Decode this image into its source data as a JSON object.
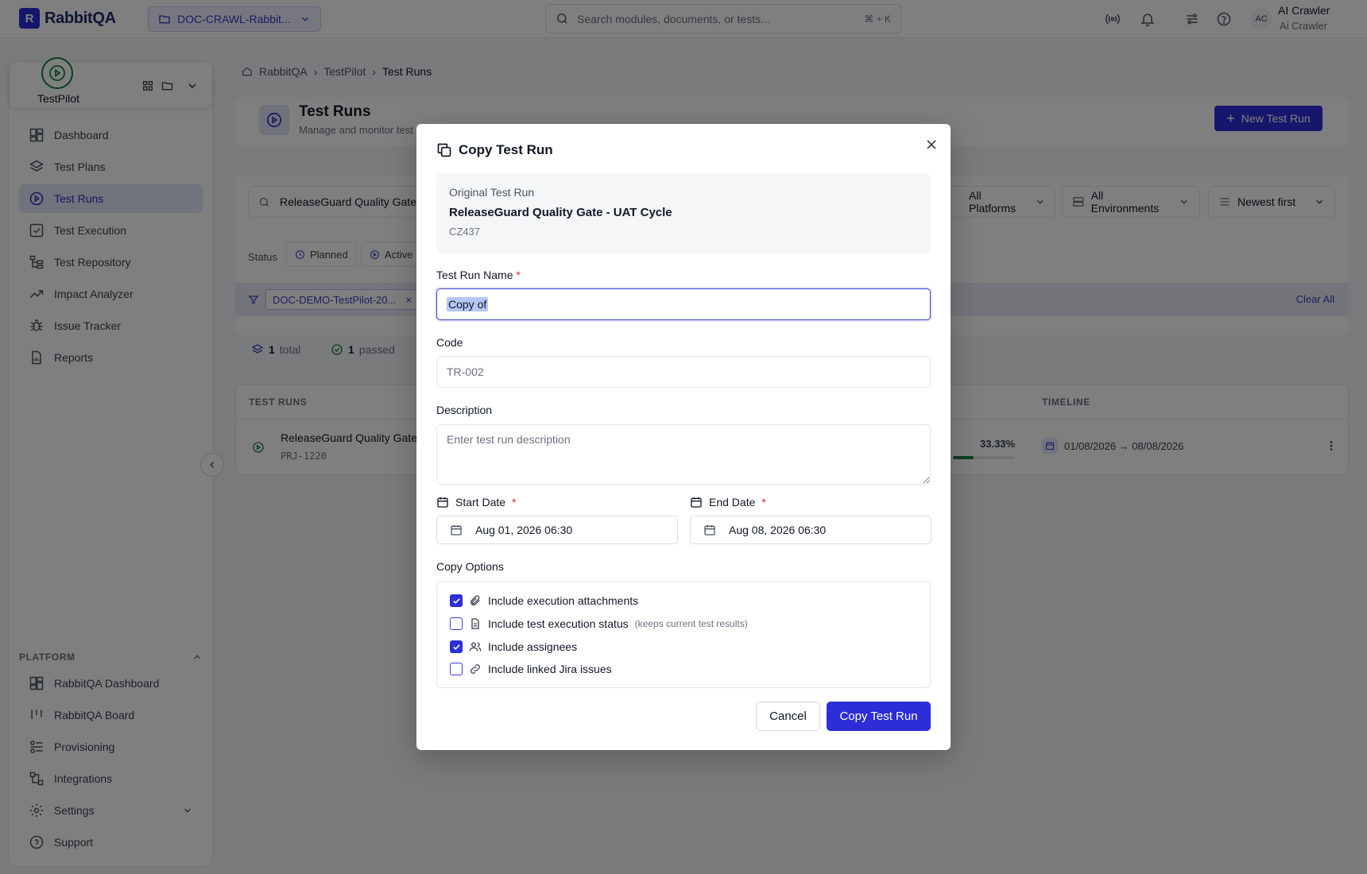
{
  "app": {
    "name": "RabbitQA"
  },
  "project_selector": {
    "label": "DOC-CRAWL-Rabbit..."
  },
  "search": {
    "placeholder": "Search modules, documents, or tests...",
    "shortcut": "⌘ + K"
  },
  "user": {
    "initials": "AC",
    "name": "AI Crawler",
    "subtitle": "Ai Crawler"
  },
  "sidebar": {
    "module": "TestPilot",
    "items": [
      {
        "label": "Dashboard",
        "icon": "dashboard-icon"
      },
      {
        "label": "Test Plans",
        "icon": "layers-icon"
      },
      {
        "label": "Test Runs",
        "icon": "play-circle-icon",
        "active": true
      },
      {
        "label": "Test Execution",
        "icon": "check-square-icon"
      },
      {
        "label": "Test Repository",
        "icon": "tree-icon"
      },
      {
        "label": "Impact Analyzer",
        "icon": "trend-icon"
      },
      {
        "label": "Issue Tracker",
        "icon": "bug-icon"
      },
      {
        "label": "Reports",
        "icon": "report-icon"
      }
    ],
    "platform_title": "PLATFORM",
    "platform_items": [
      {
        "label": "RabbitQA Dashboard",
        "icon": "dashboard-icon"
      },
      {
        "label": "RabbitQA Board",
        "icon": "board-icon"
      },
      {
        "label": "Provisioning",
        "icon": "provisioning-icon"
      },
      {
        "label": "Integrations",
        "icon": "integrations-icon"
      },
      {
        "label": "Settings",
        "icon": "gear-icon"
      },
      {
        "label": "Support",
        "icon": "help-icon"
      }
    ]
  },
  "breadcrumb": [
    "RabbitQA",
    "TestPilot",
    "Test Runs"
  ],
  "page": {
    "title": "Test Runs",
    "subtitle": "Manage and monitor test",
    "new_button": "New Test Run"
  },
  "filters": {
    "search_value": "ReleaseGuard Quality Gate -",
    "platforms": "All Platforms",
    "environments": "All Environments",
    "sort": "Newest first",
    "status_label": "Status",
    "status_chips": [
      "Planned",
      "Active"
    ],
    "active_filter": "DOC-DEMO-TestPilot-20...",
    "clear_all": "Clear All"
  },
  "stats": {
    "total_count": "1",
    "total_label": "total",
    "passed_count": "1",
    "passed_label": "passed"
  },
  "table": {
    "headers": {
      "runs": "TEST RUNS",
      "timeline": "TIMELINE"
    },
    "row": {
      "title": "ReleaseGuard Quality Gate -",
      "code": "PRJ-1220",
      "progress_text": "33.33%",
      "progress": 0.3333,
      "timeline": "01/08/2026 → 08/08/2026"
    }
  },
  "modal": {
    "title": "Copy Test Run",
    "original_label": "Original Test Run",
    "original_name": "ReleaseGuard Quality Gate - UAT Cycle",
    "original_code": "CZ437",
    "name_label": "Test Run Name",
    "name_value": "Copy of",
    "code_label": "Code",
    "code_placeholder": "TR-002",
    "description_label": "Description",
    "description_placeholder": "Enter test run description",
    "start_label": "Start Date",
    "start_value": "Aug 01, 2026 06:30",
    "end_label": "End Date",
    "end_value": "Aug 08, 2026 06:30",
    "copy_options_label": "Copy Options",
    "options": [
      {
        "label": "Include execution attachments",
        "checked": true,
        "icon": "paperclip-icon"
      },
      {
        "label": "Include test execution status",
        "hint": "(keeps current test results)",
        "checked": false,
        "icon": "document-icon"
      },
      {
        "label": "Include assignees",
        "checked": true,
        "icon": "users-icon"
      },
      {
        "label": "Include linked Jira issues",
        "checked": false,
        "icon": "link-icon"
      }
    ],
    "cancel": "Cancel",
    "submit": "Copy Test Run"
  },
  "colors": {
    "accent": "#2d2ed8",
    "success": "#15803d",
    "required": "#dc2626"
  }
}
